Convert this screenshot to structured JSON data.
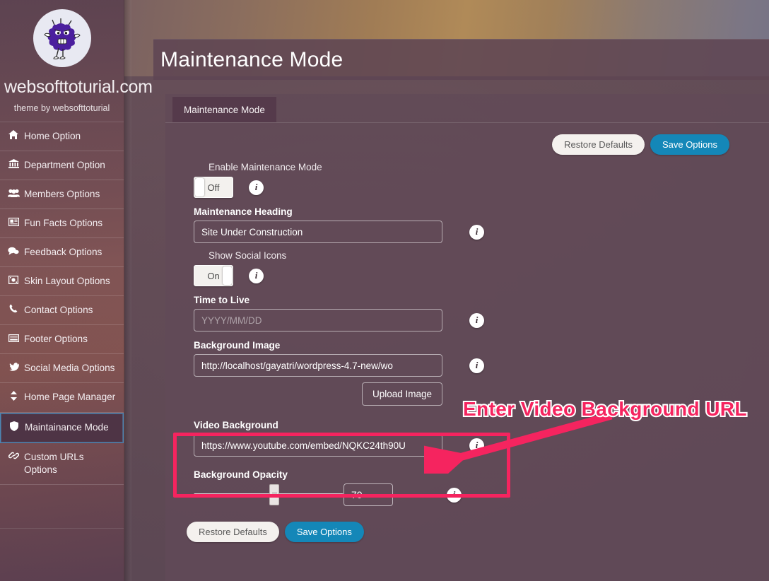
{
  "branding": {
    "site_name": "websofttoturial.com",
    "tagline": "theme by websofttoturial",
    "logo_alt": "monster-logo"
  },
  "sidebar": {
    "items": [
      {
        "label": "Home Option",
        "icon": "home-icon",
        "glyph": "⌂",
        "active": false
      },
      {
        "label": "Department Option",
        "icon": "bank-icon",
        "glyph": "ἽB",
        "active": false
      },
      {
        "label": "Members Options",
        "icon": "users-icon",
        "glyph": "\u0001",
        "active": false
      },
      {
        "label": "Fun Facts Options",
        "icon": "news-icon",
        "glyph": "\u0001",
        "active": false
      },
      {
        "label": "Feedback Options",
        "icon": "comment-icon",
        "glyph": "\u0001",
        "active": false
      },
      {
        "label": "Skin Layout Options",
        "icon": "image-icon",
        "glyph": "\u0001",
        "active": false
      },
      {
        "label": "Contact Options",
        "icon": "phone-icon",
        "glyph": "\u0001",
        "active": false
      },
      {
        "label": "Footer Options",
        "icon": "window-icon",
        "glyph": "\u0001",
        "active": false
      },
      {
        "label": "Social Media Options",
        "icon": "twitter-icon",
        "glyph": "\u0001",
        "active": false
      },
      {
        "label": "Home Page Manager",
        "icon": "sort-icon",
        "glyph": "\u0001",
        "active": false
      },
      {
        "label": "Maintainance Mode",
        "icon": "shield-icon",
        "glyph": "\u0001",
        "active": true
      },
      {
        "label": "Custom URLs Options",
        "icon": "link-icon",
        "glyph": "\u0001",
        "active": false
      }
    ]
  },
  "header": {
    "title": "Maintenance Mode"
  },
  "tabs": [
    {
      "label": "Maintenance Mode",
      "active": true
    }
  ],
  "toolbar": {
    "restore_label": "Restore Defaults",
    "save_label": "Save Options"
  },
  "fields": {
    "enable_maintenance": {
      "label": "Enable Maintenance Mode",
      "value": "Off",
      "state": "off"
    },
    "maintenance_heading": {
      "label": "Maintenance Heading",
      "value": "Site Under Construction",
      "placeholder": ""
    },
    "show_social_icons": {
      "label": "Show Social Icons",
      "value": "On",
      "state": "on"
    },
    "time_to_live": {
      "label": "Time to Live",
      "value": "",
      "placeholder": "YYYY/MM/DD"
    },
    "background_image": {
      "label": "Background Image",
      "value": "http://localhost/gayatri/wordpress-4.7-new/wo",
      "upload_label": "Upload Image"
    },
    "video_background": {
      "label": "Video Background",
      "value": "https://www.youtube.com/embed/NQKC24th90U",
      "placeholder": ""
    },
    "background_opacity": {
      "label": "Background Opacity",
      "value": "70",
      "slider_percent": 54
    }
  },
  "footer_toolbar": {
    "restore_label": "Restore Defaults",
    "save_label": "Save Options"
  },
  "annotation": {
    "text": "Enter Video Background URL",
    "color": "#f5245f"
  },
  "colors": {
    "accent_blue": "#1487b8",
    "annotation_pink": "#f5245f",
    "sidebar_active": "#4e3445",
    "active_border": "#4a86b5"
  }
}
